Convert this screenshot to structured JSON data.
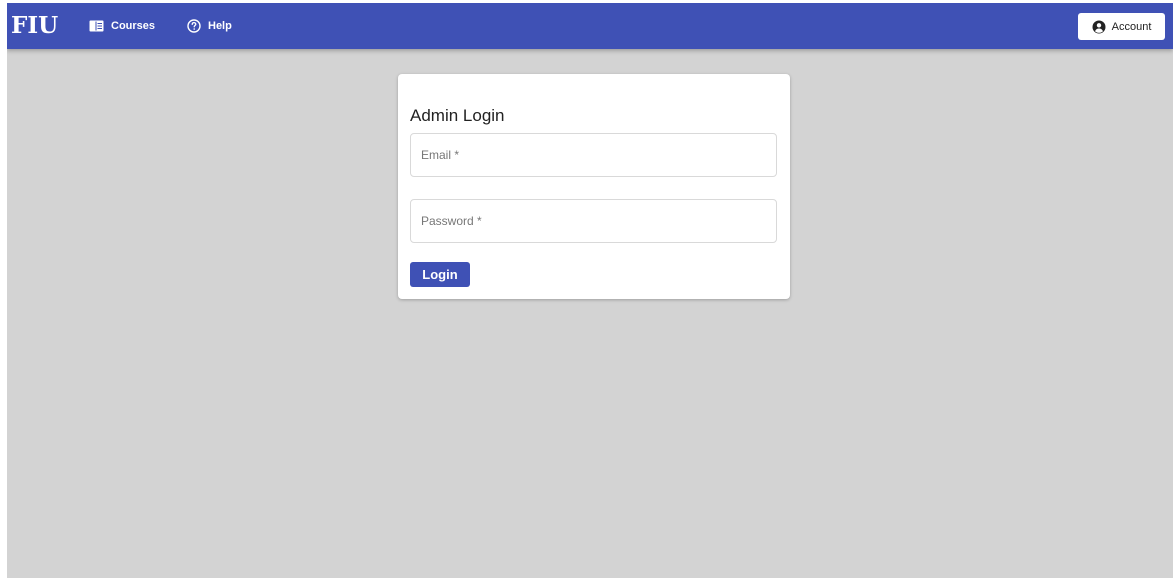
{
  "header": {
    "logo_text": "FIU",
    "nav": [
      {
        "label": "Courses",
        "icon": "book-icon"
      },
      {
        "label": "Help",
        "icon": "help-circle-icon"
      }
    ],
    "account_label": "Account",
    "account_icon": "account-circle-icon"
  },
  "login_card": {
    "title": "Admin Login",
    "email_placeholder": "Email *",
    "email_value": "",
    "password_placeholder": "Password *",
    "password_value": "",
    "submit_label": "Login"
  },
  "colors": {
    "primary": "#3f51b5",
    "background": "#d3d3d3",
    "card": "#ffffff"
  }
}
